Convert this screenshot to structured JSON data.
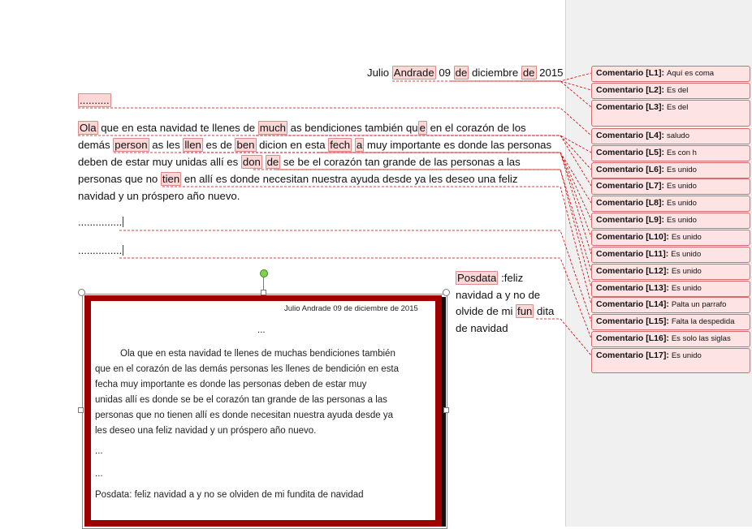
{
  "document": {
    "date_line": {
      "before": "Julio ",
      "w1": "Andrade",
      "mid1": " 09 ",
      "w2": "de",
      "mid2": " diciembre ",
      "w3": "de",
      "after": " 2015"
    },
    "dots_line": "..........",
    "body": {
      "l1": {
        "w1": "Ola",
        "t1": " que en esta navidad te llenes de ",
        "w2": "much",
        "t2": " as  bendiciones  también qu",
        "w3": "e",
        "t3": " en el corazón de los"
      },
      "l2": {
        "t0": "demás ",
        "w1": "person",
        "t1": " as les ",
        "w2": "llen",
        "t2": " es de ",
        "w3": "ben",
        "t3": " dicion en esta ",
        "w4": "fech",
        "t4": " ",
        "w5": "a",
        "t5": " muy importante es donde las personas"
      },
      "l3": {
        "t0": "deben de estar muy unidas allí es ",
        "w1": "don",
        "t1": " ",
        "w2": "de",
        "t2": " se be el corazón tan grande de las personas a las"
      },
      "l4": {
        "t0": "personas que no ",
        "w1": "tien",
        "t1": " en allí es donde necesitan nuestra ayuda desde ya les deseo una feliz"
      },
      "l5": "navidad  y un próspero año nuevo."
    },
    "dots_a": "...............",
    "dots_b": "...............",
    "posdata": {
      "w1": "Posdata",
      "t1": " :feliz",
      "l2": "navidad a y no de",
      "l3a": "olvide de mi ",
      "w2": "fun",
      "l3b": " dita",
      "l4": "de navidad"
    }
  },
  "image_text": {
    "date": "Julio Andrade 09 de diciembre de 2015",
    "ellipsis": "...",
    "p1": "Ola que en esta navidad te llenes de muchas bendiciones también",
    "p2": "que en el corazón de las demás personas les llenes de bendición en esta",
    "p3": "fecha muy importante es donde las personas deben de estar muy",
    "p4": "unidas allí es donde se be el corazón tan grande de las personas  a las",
    "p5": "personas que no tienen allí es donde necesitan nuestra ayuda desde ya",
    "p6": "les deseo una feliz navidad y un próspero año nuevo.",
    "e2": "...",
    "e3": "...",
    "posdata": "Posdata: feliz navidad a y no se olviden de mi fundita de navidad"
  },
  "comments": [
    {
      "title": "Comentario [L1]:",
      "text": "Aquí es coma"
    },
    {
      "title": "Comentario [L2]:",
      "text": "Es del"
    },
    {
      "title": "Comentario [L3]:",
      "text": "Es del"
    },
    {
      "title": "Comentario [L4]:",
      "text": "saludo"
    },
    {
      "title": "Comentario [L5]:",
      "text": "Es con h"
    },
    {
      "title": "Comentario [L6]:",
      "text": "Es unido"
    },
    {
      "title": "Comentario [L7]:",
      "text": "Es unido"
    },
    {
      "title": "Comentario [L8]:",
      "text": "Es unido"
    },
    {
      "title": "Comentario [L9]:",
      "text": "Es unido"
    },
    {
      "title": "Comentario [L10]:",
      "text": "Es unido"
    },
    {
      "title": "Comentario [L11]:",
      "text": "Es unido"
    },
    {
      "title": "Comentario [L12]:",
      "text": "Es unido"
    },
    {
      "title": "Comentario [L13]:",
      "text": "Es unido"
    },
    {
      "title": "Comentario [L14]:",
      "text": "Palta un parrafo"
    },
    {
      "title": "Comentario [L15]:",
      "text": "Falta la despedida"
    },
    {
      "title": "Comentario [L16]:",
      "text": "Es solo las siglas"
    },
    {
      "title": "Comentario [L17]:",
      "text": "Es unido"
    }
  ],
  "colors": {
    "comment_fill": "#fde3e3",
    "comment_border": "#d66b6b",
    "frame_red": "#a00000",
    "leader_red": "#d00000"
  }
}
